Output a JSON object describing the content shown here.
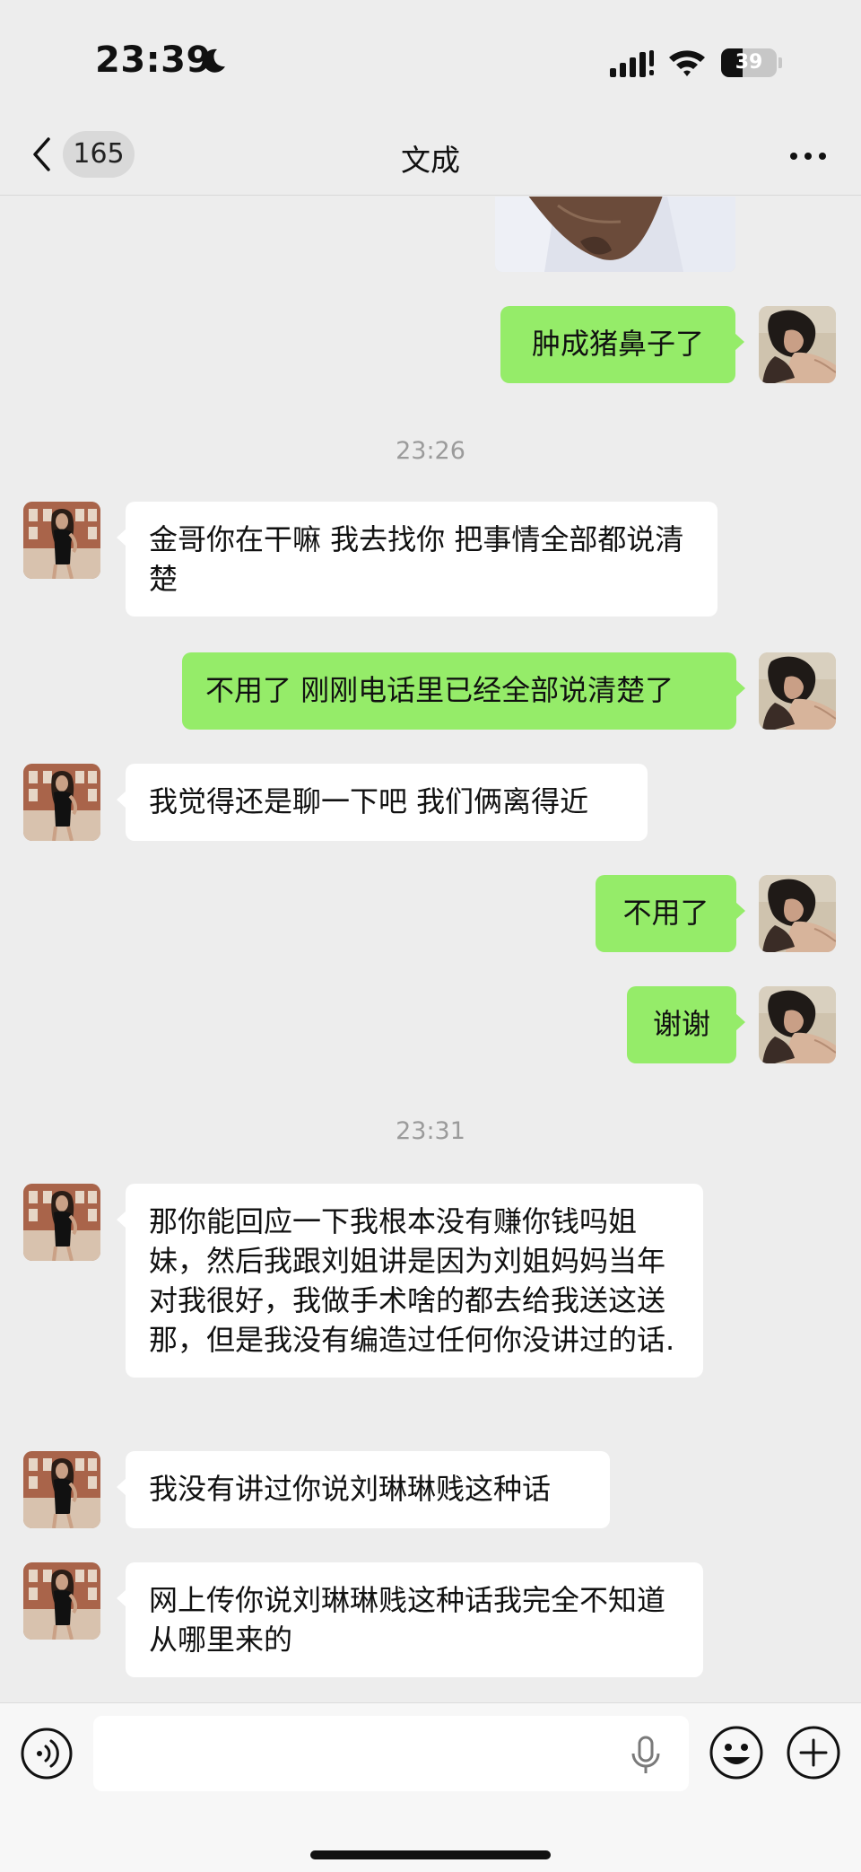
{
  "status_bar": {
    "time": "23:39",
    "battery_level": "39"
  },
  "header": {
    "back_count": "165",
    "title": "文成"
  },
  "messages": {
    "m0": "肿成猪鼻子了",
    "t1": "23:26",
    "m1": "金哥你在干嘛 我去找你 把事情全部都说清楚",
    "m2": "不用了 刚刚电话里已经全部说清楚了",
    "m3": "我觉得还是聊一下吧 我们俩离得近",
    "m4": "不用了",
    "m5": "谢谢",
    "t2": "23:31",
    "m6": "那你能回应一下我根本没有赚你钱吗姐妹，然后我跟刘姐讲是因为刘姐妈妈当年对我很好，我做手术啥的都去给我送这送那，但是我没有编造过任何你没讲过的话.",
    "m7": "我没有讲过你说刘琳琳贱这种话",
    "m8": "网上传你说刘琳琳贱这种话我完全不知道从哪里来的"
  },
  "colors": {
    "background": "#ededed",
    "bubble_outgoing": "#95ec69",
    "bubble_incoming": "#ffffff",
    "timestamp": "#9b9b9b"
  },
  "icons": {
    "moon": "moon-icon",
    "signal": "cellular-signal-icon",
    "wifi": "wifi-icon",
    "back": "chevron-left-icon",
    "more": "more-dots-icon",
    "voice": "voice-mode-icon",
    "mic": "microphone-icon",
    "emoji": "emoji-icon",
    "plus": "plus-icon"
  }
}
